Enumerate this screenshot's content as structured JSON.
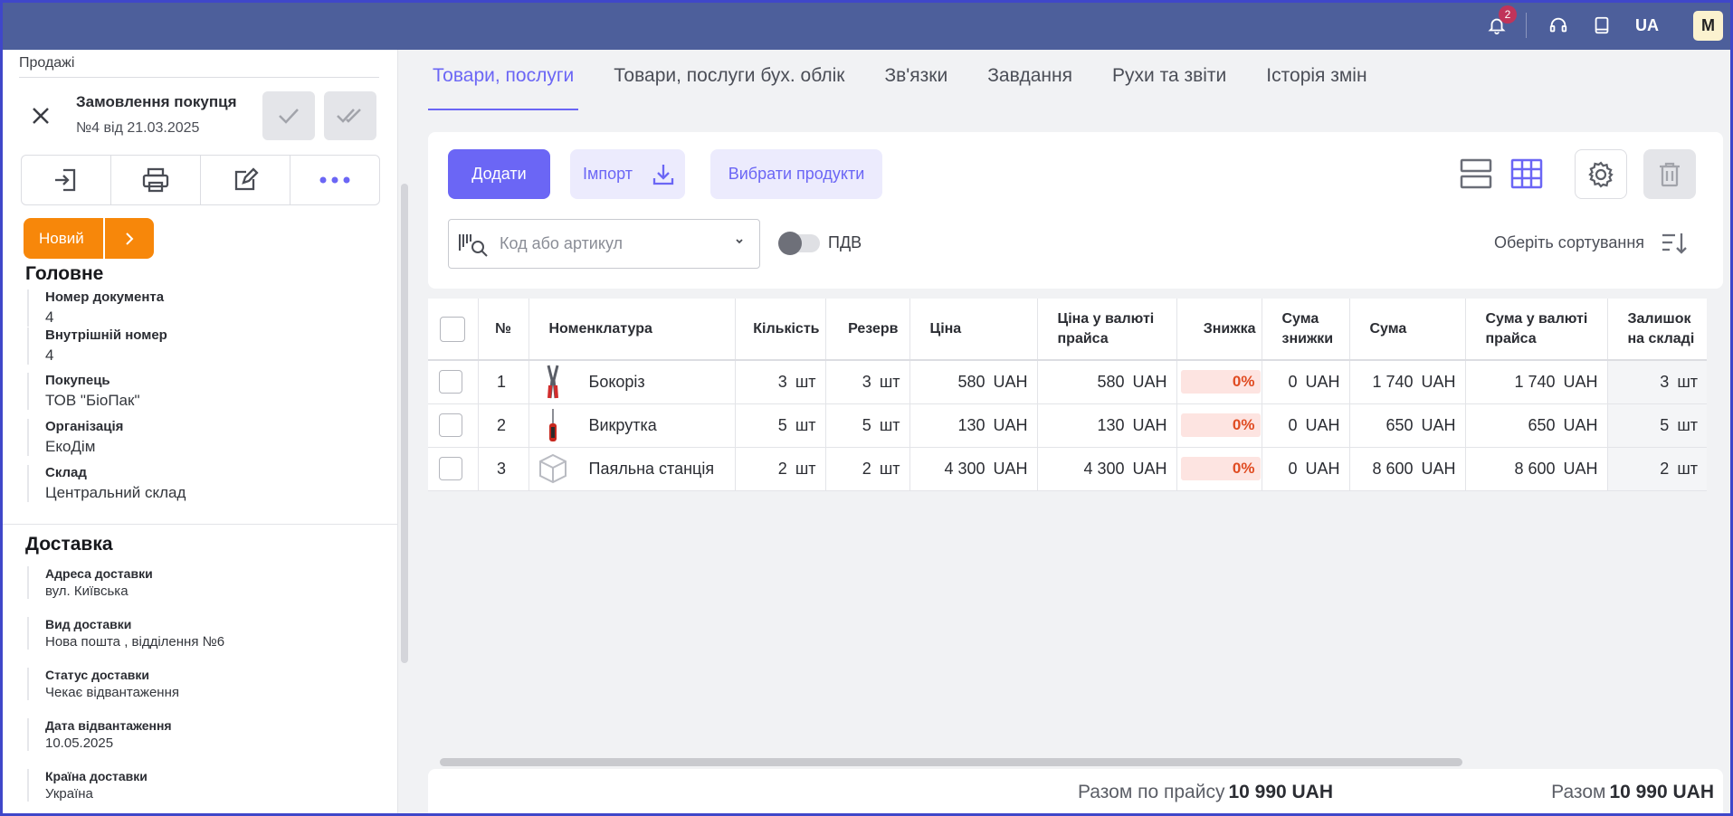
{
  "topbar": {
    "notifications_count": "2",
    "language": "UA",
    "avatar_letter": "M"
  },
  "sidebar": {
    "section": "Продажі",
    "doc_title": "Замовлення покупця",
    "doc_subtitle": "№4 від 21.03.2025",
    "status": "Новий",
    "main": {
      "title": "Головне",
      "fields": [
        {
          "label": "Номер документа",
          "value": "4"
        },
        {
          "label": "Внутрішній номер",
          "value": "4"
        },
        {
          "label": "Покупець",
          "value": "ТОВ \"БіоПак\""
        },
        {
          "label": "Організація",
          "value": "ЕкоДім"
        },
        {
          "label": "Склад",
          "value": "Центральний склад"
        }
      ]
    },
    "delivery": {
      "title": "Доставка",
      "fields": [
        {
          "label": "Адреса доставки",
          "value": "вул. Київська"
        },
        {
          "label": "Вид доставки",
          "value": "Нова пошта , відділення №6"
        },
        {
          "label": "Статус доставки",
          "value": "Чекає відвантаження"
        },
        {
          "label": "Дата відвантаження",
          "value": "10.05.2025"
        },
        {
          "label": "Країна доставки",
          "value": "Україна"
        }
      ]
    }
  },
  "tabs": [
    {
      "label": "Товари, послуги"
    },
    {
      "label": "Товари, послуги бух. облік"
    },
    {
      "label": "Зв'язки"
    },
    {
      "label": "Завдання"
    },
    {
      "label": "Рухи та звіти"
    },
    {
      "label": "Історія змін"
    }
  ],
  "toolbar": {
    "add": "Додати",
    "import": "Імпорт",
    "choose": "Вибрати продукти",
    "search_placeholder": "Код або артикул",
    "vat": "ПДВ",
    "sort": "Оберіть сортування"
  },
  "table": {
    "headers": {
      "no": "№",
      "name": "Номенклатура",
      "qty": "Кількість",
      "reserve": "Резерв",
      "price": "Ціна",
      "price_list": "Ціна у валюті прайса",
      "discount": "Знижка",
      "discount_sum": "Сума знижки",
      "sum": "Сума",
      "sum_list": "Сума у валюті прайса",
      "stock": "Залишок на складі"
    },
    "unit": "шт",
    "currency": "UAH",
    "rows": [
      {
        "no": "1",
        "name": "Бокоріз",
        "icon": "pliers-image",
        "qty": "3",
        "reserve": "3",
        "price": "580",
        "price_list": "580",
        "discount": "0%",
        "discount_sum": "0",
        "sum": "1 740",
        "sum_list": "1 740",
        "stock": "3"
      },
      {
        "no": "2",
        "name": "Викрутка",
        "icon": "screwdriver-image",
        "qty": "5",
        "reserve": "5",
        "price": "130",
        "price_list": "130",
        "discount": "0%",
        "discount_sum": "0",
        "sum": "650",
        "sum_list": "650",
        "stock": "5"
      },
      {
        "no": "3",
        "name": "Паяльна станція",
        "icon": "box-placeholder-icon",
        "qty": "2",
        "reserve": "2",
        "price": "4 300",
        "price_list": "4 300",
        "discount": "0%",
        "discount_sum": "0",
        "sum": "8 600",
        "sum_list": "8 600",
        "stock": "2"
      }
    ]
  },
  "footer": {
    "total_price_label": "Разом по прайсу",
    "total_price_value": "10 990 UAH",
    "total_label": "Разом",
    "total_value": "10 990 UAH"
  },
  "colors": {
    "accent": "#6b66f5",
    "topbar": "#4d5f9b",
    "status": "#f7870a",
    "discount": "#e04b21"
  }
}
